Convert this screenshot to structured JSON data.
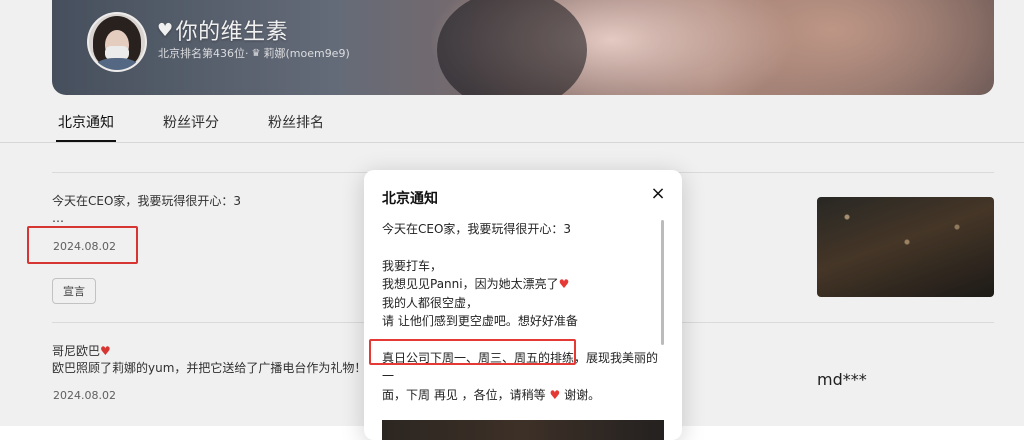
{
  "banner": {
    "title": "你的维生素",
    "subtitle_rank": "北京排名第436位·",
    "subtitle_name": "莉娜(moem9e9)",
    "icons": {
      "title": "heart-icon",
      "subtitle": "crown-icon"
    }
  },
  "tabs": [
    "北京通知",
    "粉丝评分",
    "粉丝排名"
  ],
  "feed": [
    {
      "text_line1": "今天在CEO家，我要玩得很开心：3",
      "text_line2": "…",
      "date": "2024.08.02",
      "tag": "宣言"
    },
    {
      "text_line1": "哥尼欧巴",
      "text_line2": "欧巴照顾了莉娜的yum，并把它送给了广播电台作为礼物！…",
      "date": "2024.08.02"
    }
  ],
  "side_label": "md***",
  "modal": {
    "title": "北京通知",
    "close_glyph": "×",
    "lines": {
      "l1": "今天在CEO家，我要玩得很开心：3",
      "l2": "我要打车，",
      "l3": "我想见见Panni，因为她太漂亮了",
      "l4": "我的人都很空虚，",
      "l5": "请 让他们感到更空虚吧。想好好准备",
      "l6a": "真日公司下周一、周三、周五的排练，",
      "l6b": "展现我美丽的一",
      "l7a": "面，下周 再见 ，各位，请稍等",
      "l7b": "谢谢。"
    }
  },
  "colors": {
    "annotation_red": "#e53935",
    "heart_red": "#e53935",
    "tab_underline": "#111111"
  }
}
